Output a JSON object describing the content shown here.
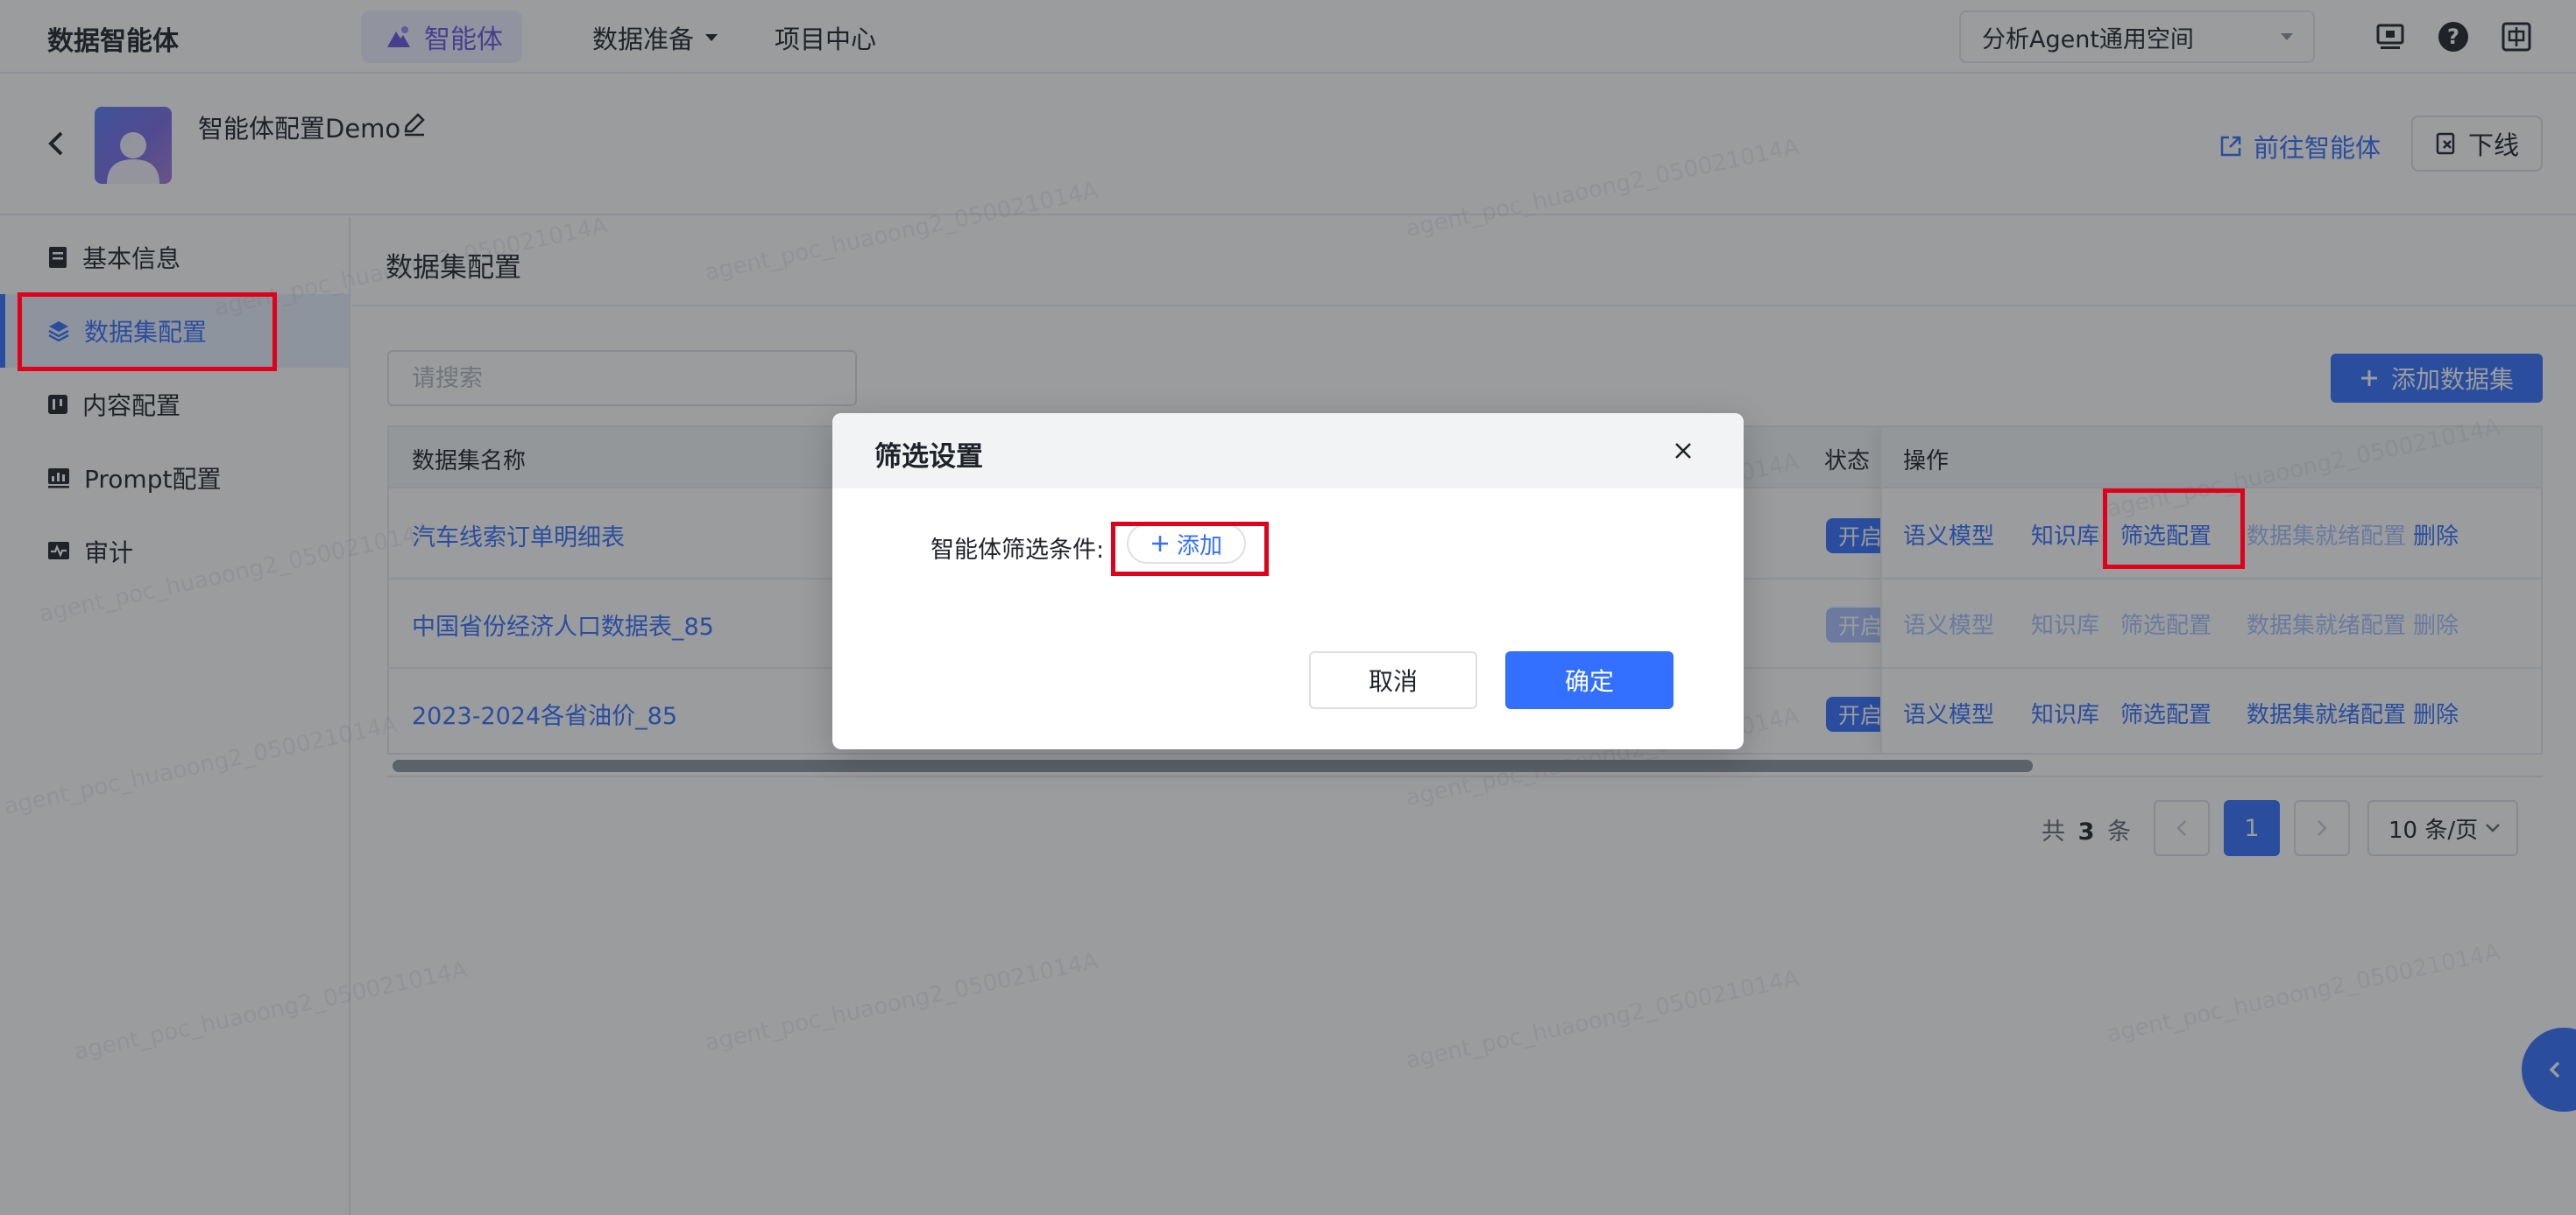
{
  "topbar": {
    "app_title": "数据智能体",
    "nav": [
      {
        "label": "智能体",
        "active": true
      },
      {
        "label": "数据准备"
      },
      {
        "label": "项目中心"
      }
    ],
    "workspace": "分析Agent通用空间",
    "icons": [
      "monitor-icon",
      "help-icon",
      "language-icon"
    ]
  },
  "agent": {
    "name": "智能体配置Demo",
    "goto_label": "前往智能体",
    "offline_label": "下线"
  },
  "sidebar": {
    "items": [
      {
        "label": "基本信息",
        "icon": "document-icon"
      },
      {
        "label": "数据集配置",
        "icon": "layers-icon",
        "active": true
      },
      {
        "label": "内容配置",
        "icon": "content-icon"
      },
      {
        "label": "Prompt配置",
        "icon": "chart-icon"
      },
      {
        "label": "审计",
        "icon": "audit-icon"
      }
    ]
  },
  "main": {
    "title": "数据集配置",
    "search_placeholder": "请搜索",
    "add_dataset_label": "添加数据集",
    "table": {
      "columns": {
        "name": "数据集名称",
        "status": "状态",
        "ops": "操作"
      },
      "rows": [
        {
          "name": "汽车线索订单明细表",
          "status": "开启",
          "status_muted": false,
          "ops_disabled": false
        },
        {
          "name": "中国省份经济人口数据表_85",
          "status": "开启",
          "status_muted": true,
          "ops_disabled": true
        },
        {
          "name": "2023-2024各省油价_85",
          "status": "开启",
          "status_muted": false,
          "ops_disabled": false
        }
      ],
      "ops": [
        "语义模型",
        "知识库",
        "筛选配置",
        "数据集就绪配置",
        "删除"
      ]
    },
    "pagination": {
      "total_prefix": "共",
      "total": "3",
      "total_suffix": "条",
      "current_page": "1",
      "page_size": "10 条/页"
    }
  },
  "watermark_text": "agent_poc_huaoong2_050021014A",
  "dialog": {
    "title": "筛选设置",
    "filter_label": "智能体筛选条件:",
    "add_label": "添加",
    "cancel_label": "取消",
    "ok_label": "确定"
  },
  "colors": {
    "primary": "#3370ff",
    "highlight": "#e0001b",
    "nav_active": "#6b55e6"
  }
}
